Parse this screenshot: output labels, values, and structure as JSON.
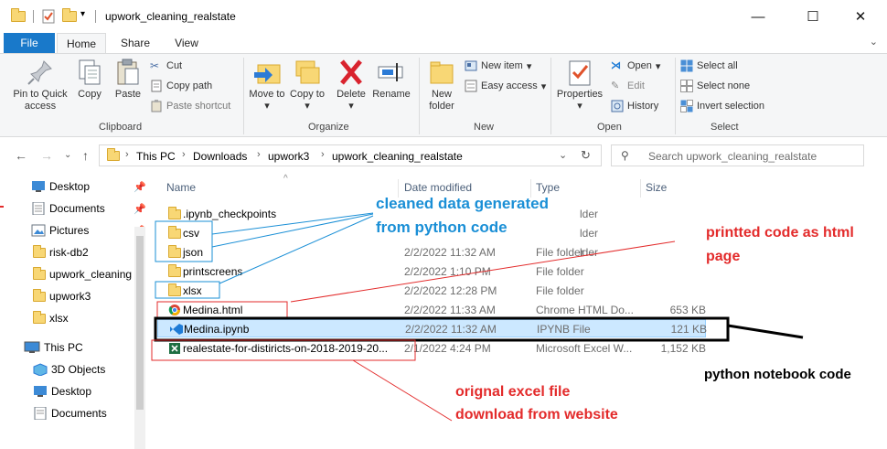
{
  "window": {
    "title": "upwork_cleaning_realstate",
    "minimize": "—",
    "maximize": "☐",
    "close": "✕"
  },
  "ribbon_tabs": {
    "file": "File",
    "home": "Home",
    "share": "Share",
    "view": "View"
  },
  "ribbon": {
    "clipboard": {
      "label": "Clipboard",
      "pin": "Pin to Quick access",
      "copy": "Copy",
      "paste": "Paste",
      "cut": "Cut",
      "copy_path": "Copy path",
      "paste_shortcut": "Paste shortcut"
    },
    "organize": {
      "label": "Organize",
      "move_to": "Move to",
      "copy_to": "Copy to",
      "delete": "Delete",
      "rename": "Rename"
    },
    "new": {
      "label": "New",
      "new_folder": "New folder",
      "new_item": "New item",
      "easy_access": "Easy access"
    },
    "open": {
      "label": "Open",
      "properties": "Properties",
      "open": "Open",
      "edit": "Edit",
      "history": "History"
    },
    "select": {
      "label": "Select",
      "select_all": "Select all",
      "select_none": "Select none",
      "invert_selection": "Invert selection"
    }
  },
  "address": {
    "crumbs": [
      "This PC",
      "Downloads",
      "upwork3",
      "upwork_cleaning_realstate"
    ],
    "search_placeholder": "Search upwork_cleaning_realstate"
  },
  "nav_pane": {
    "quick_access": [
      {
        "label": "Desktop",
        "pinned": true
      },
      {
        "label": "Documents",
        "pinned": true
      },
      {
        "label": "Pictures",
        "pinned": true
      },
      {
        "label": "risk-db2",
        "pinned": false
      },
      {
        "label": "upwork_cleaning",
        "pinned": false
      },
      {
        "label": "upwork3",
        "pinned": false
      },
      {
        "label": "xlsx",
        "pinned": false
      }
    ],
    "this_pc": "This PC",
    "this_pc_items": [
      "3D Objects",
      "Desktop",
      "Documents"
    ]
  },
  "columns": {
    "name": "Name",
    "date_modified": "Date modified",
    "type": "Type",
    "size": "Size"
  },
  "files": [
    {
      "name": ".ipynb_checkpoints",
      "date": "",
      "type": "lder",
      "size": "",
      "icon": "folder"
    },
    {
      "name": "csv",
      "date": "",
      "type": "lder",
      "size": "",
      "icon": "folder"
    },
    {
      "name": "json",
      "date": "",
      "type": "lder",
      "size": "",
      "icon": "folder"
    },
    {
      "name": "xlsx",
      "date": "2/2/2022 11:32 AM",
      "type": "File folder",
      "size": "",
      "icon": "folder"
    },
    {
      "name": "printscreens",
      "date": "2/2/2022 1:10 PM",
      "type": "File folder",
      "size": "",
      "icon": "folder"
    },
    {
      "name": "xlsx",
      "date": "2/2/2022 12:28 PM",
      "type": "File folder",
      "size": "",
      "icon": "folder"
    },
    {
      "name": "Medina.html",
      "date": "2/2/2022 11:33 AM",
      "type": "Chrome HTML Do...",
      "size": "653 KB",
      "icon": "chrome"
    },
    {
      "name": "Medina.ipynb",
      "date": "2/2/2022 11:32 AM",
      "type": "IPYNB File",
      "size": "121 KB",
      "icon": "vscode"
    },
    {
      "name": "realestate-for-distiricts-on-2018-2019-20...",
      "date": "2/1/2022 4:24 PM",
      "type": "Microsoft Excel W...",
      "size": "1,152 KB",
      "icon": "excel"
    }
  ],
  "annotations": {
    "cleaned_line1": "cleaned data generated",
    "cleaned_line2": "from python code",
    "printed_line1": "printted code as html",
    "printed_line2": "page",
    "notebook": "python notebook code",
    "excel_line1": "orignal excel file",
    "excel_line2": "download from website"
  },
  "colors": {
    "file_tab": "#1979ca",
    "annotation_blue": "#1a8fd6",
    "annotation_red": "#e32b2b",
    "selection": "#cce8ff"
  }
}
